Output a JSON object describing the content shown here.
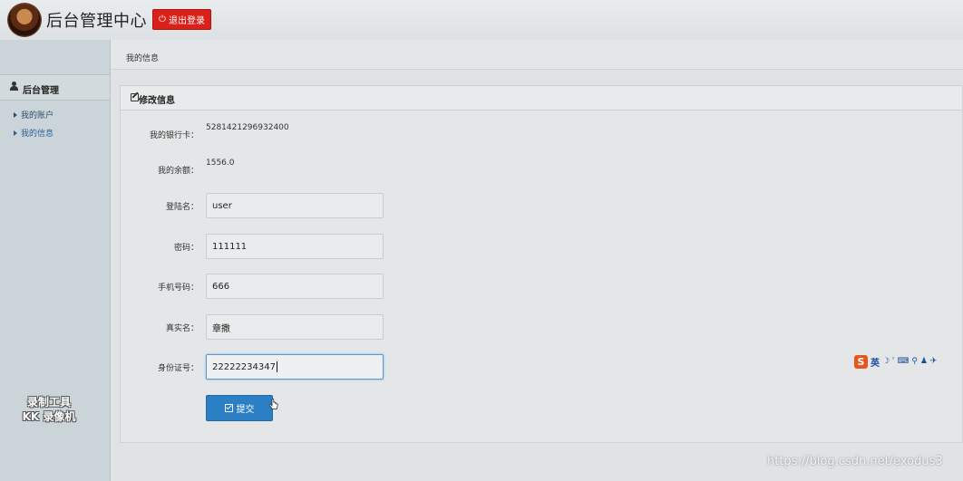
{
  "header": {
    "title": "后台管理中心",
    "logout_label": "退出登录",
    "logout_icon": "power-icon"
  },
  "breadcrumb": {
    "current": "我的信息"
  },
  "sidebar": {
    "section_title": "后台管理",
    "items": [
      {
        "label": "我的账户"
      },
      {
        "label": "我的信息"
      }
    ],
    "watermark_line1": "录制工具",
    "watermark_line2": "KK 录像机"
  },
  "panel": {
    "title": "修改信息",
    "bank_card_label": "我的银行卡：",
    "bank_card_value": "5281421296932400",
    "balance_label": "我的余额：",
    "balance_value": "1556.0",
    "username_label": "登陆名：",
    "username_value": "user",
    "password_label": "密码：",
    "password_value": "111111",
    "phone_label": "手机号码：",
    "phone_value": "666",
    "realname_label": "真实名：",
    "realname_value": "章撒",
    "idcard_label": "身份证号：",
    "idcard_value": "22222234347",
    "submit_label": "提交"
  },
  "ime": {
    "logo": "S",
    "lang": "英",
    "glyphs": "☽ ʾ ⌨ ⚲ ♟ ✈"
  },
  "footer": {
    "url": "https://blog.csdn.net/exodus3"
  },
  "colors": {
    "logout": "#d9201a",
    "submit": "#2b7fc4",
    "link": "#2a6496"
  }
}
